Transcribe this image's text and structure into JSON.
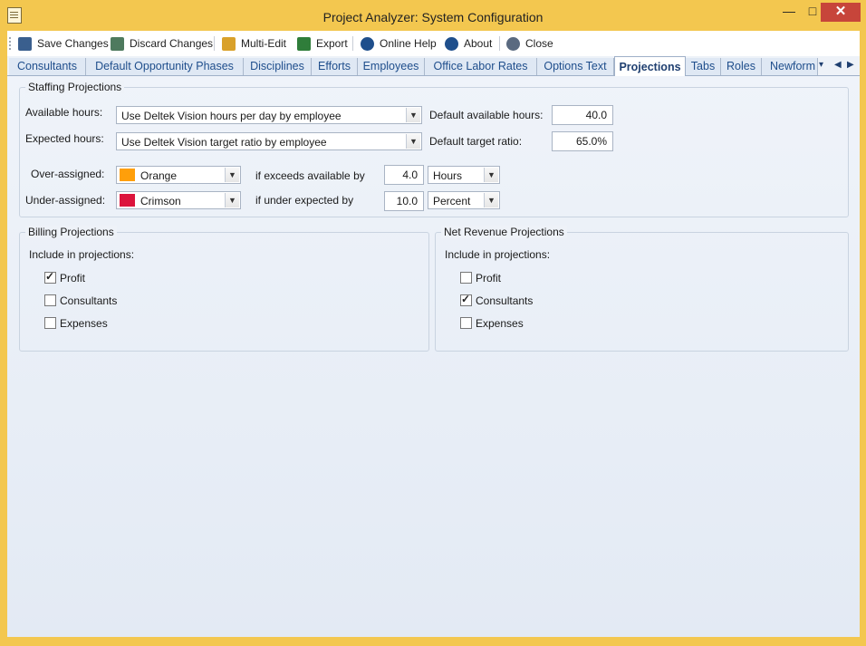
{
  "window": {
    "title": "Project Analyzer: System Configuration",
    "minimize": "—",
    "maximize": "□",
    "close": "✕"
  },
  "toolbar": {
    "save": "Save Changes",
    "discard": "Discard Changes",
    "multi_edit": "Multi-Edit",
    "export": "Export",
    "help": "Online Help",
    "about": "About",
    "close": "Close"
  },
  "tabs": [
    "Consultants",
    "Default Opportunity Phases",
    "Disciplines",
    "Efforts",
    "Employees",
    "Office Labor Rates",
    "Options Text",
    "Projections",
    "Tabs",
    "Roles",
    "Newform"
  ],
  "active_tab": "Projections",
  "staffing": {
    "title": "Staffing Projections",
    "available_label": "Available hours:",
    "available_value": "Use Deltek Vision hours per day by employee",
    "default_available_label": "Default available hours:",
    "default_available_value": "40.0",
    "expected_label": "Expected hours:",
    "expected_value": "Use Deltek Vision target ratio by employee",
    "default_target_label": "Default target ratio:",
    "default_target_value": "65.0%",
    "over_label": "Over-assigned:",
    "over_color": "Orange",
    "over_color_hex": "#ff9f0a",
    "over_cond": "if exceeds available by",
    "over_amount": "4.0",
    "over_unit": "Hours",
    "under_label": "Under-assigned:",
    "under_color": "Crimson",
    "under_color_hex": "#dc143c",
    "under_cond": "if under expected by",
    "under_amount": "10.0",
    "under_unit": "Percent"
  },
  "billing": {
    "title": "Billing Projections",
    "include": "Include in projections:",
    "items": [
      {
        "label": "Profit",
        "checked": true
      },
      {
        "label": "Consultants",
        "checked": false
      },
      {
        "label": "Expenses",
        "checked": false
      }
    ]
  },
  "netrev": {
    "title": "Net Revenue Projections",
    "include": "Include in projections:",
    "items": [
      {
        "label": "Profit",
        "checked": false
      },
      {
        "label": "Consultants",
        "checked": true
      },
      {
        "label": "Expenses",
        "checked": false
      }
    ]
  }
}
